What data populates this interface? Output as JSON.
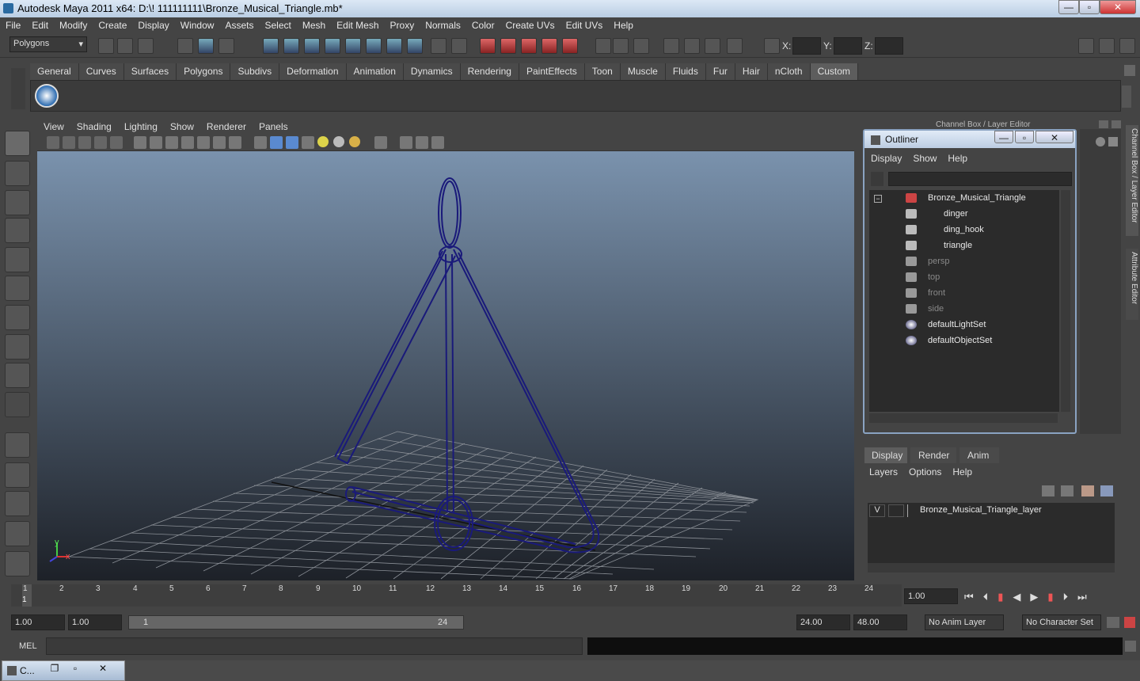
{
  "window": {
    "title": "Autodesk Maya 2011 x64: D:\\! 111111111\\Bronze_Musical_Triangle.mb*",
    "btn_min": "—",
    "btn_max": "▫",
    "btn_close": "✕"
  },
  "menu": [
    "File",
    "Edit",
    "Modify",
    "Create",
    "Display",
    "Window",
    "Assets",
    "Select",
    "Mesh",
    "Edit Mesh",
    "Proxy",
    "Normals",
    "Color",
    "Create UVs",
    "Edit UVs",
    "Help"
  ],
  "statusline": {
    "mode": "Polygons",
    "x_label": "X:",
    "y_label": "Y:",
    "z_label": "Z:"
  },
  "shelf_tabs": [
    "General",
    "Curves",
    "Surfaces",
    "Polygons",
    "Subdivs",
    "Deformation",
    "Animation",
    "Dynamics",
    "Rendering",
    "PaintEffects",
    "Toon",
    "Muscle",
    "Fluids",
    "Fur",
    "Hair",
    "nCloth",
    "Custom"
  ],
  "shelf_active": "Custom",
  "viewport_menu": [
    "View",
    "Shading",
    "Lighting",
    "Show",
    "Renderer",
    "Panels"
  ],
  "channel_box_label": "Channel Box / Layer Editor",
  "side_tabs": [
    "Channel Box / Layer Editor",
    "Attribute Editor"
  ],
  "outliner": {
    "title": "Outliner",
    "menu": [
      "Display",
      "Show",
      "Help"
    ],
    "items": [
      {
        "label": "Bronze_Musical_Triangle",
        "indent": 0,
        "dim": false
      },
      {
        "label": "dinger",
        "indent": 1,
        "dim": false
      },
      {
        "label": "ding_hook",
        "indent": 1,
        "dim": false
      },
      {
        "label": "triangle",
        "indent": 1,
        "dim": false
      },
      {
        "label": "persp",
        "indent": 0,
        "dim": true
      },
      {
        "label": "top",
        "indent": 0,
        "dim": true
      },
      {
        "label": "front",
        "indent": 0,
        "dim": true
      },
      {
        "label": "side",
        "indent": 0,
        "dim": true
      },
      {
        "label": "defaultLightSet",
        "indent": 0,
        "dim": false
      },
      {
        "label": "defaultObjectSet",
        "indent": 0,
        "dim": false
      }
    ]
  },
  "layer_editor": {
    "tabs": [
      "Display",
      "Render",
      "Anim"
    ],
    "menu": [
      "Layers",
      "Options",
      "Help"
    ],
    "layer_visible": "V",
    "layer_name": "Bronze_Musical_Triangle_layer"
  },
  "timeline": {
    "ticks": [
      "1",
      "2",
      "3",
      "4",
      "5",
      "6",
      "7",
      "8",
      "9",
      "10",
      "11",
      "12",
      "13",
      "14",
      "15",
      "16",
      "17",
      "18",
      "19",
      "20",
      "21",
      "22",
      "23",
      "24"
    ],
    "current_frame": "1.00",
    "current_tick": "1"
  },
  "range": {
    "start": "1.00",
    "playback_start": "1.00",
    "slider_start": "1",
    "slider_end": "24",
    "playback_end": "24.00",
    "end": "48.00",
    "anim_layer": "No Anim Layer",
    "char_set": "No Character Set"
  },
  "mel": {
    "label": "MEL"
  },
  "taskbar": {
    "label": "C..."
  },
  "axis": {
    "y": "y",
    "x": "x"
  },
  "colors": {
    "accent": "#5d5d5d",
    "wire": "#1a1a7a"
  }
}
